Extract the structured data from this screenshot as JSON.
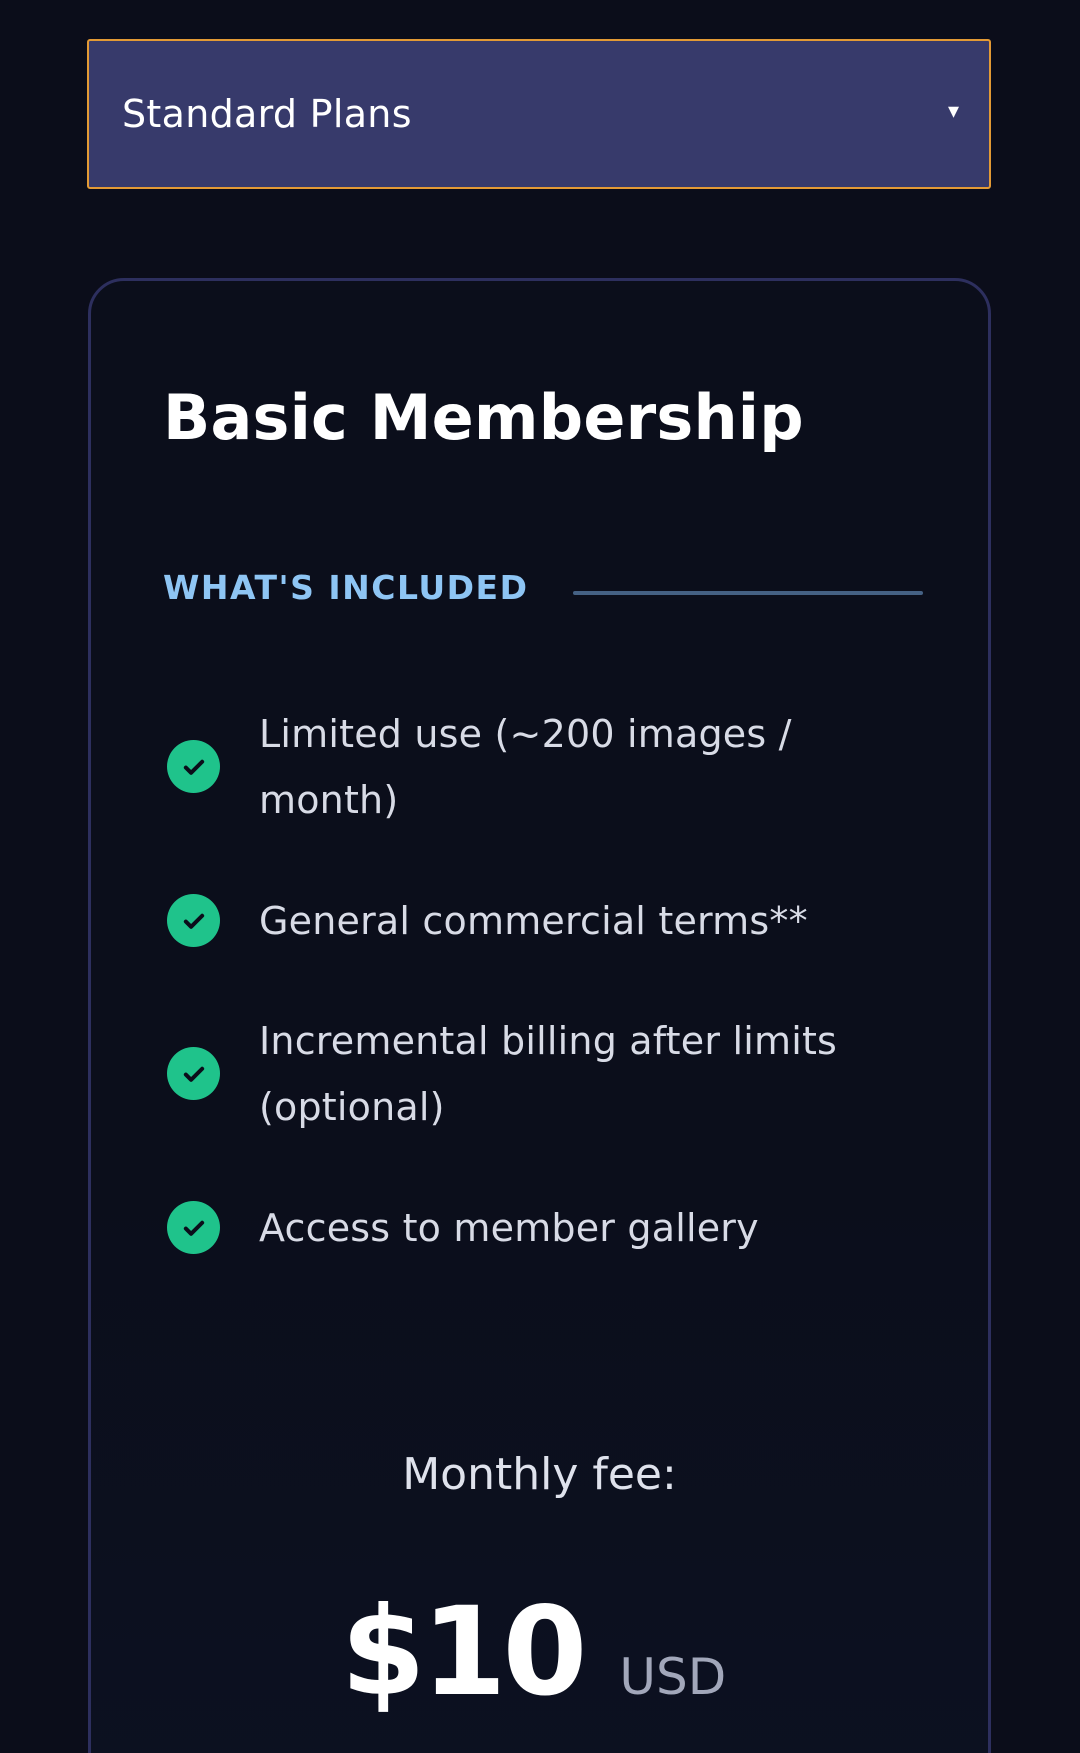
{
  "plan_selector": {
    "selected": "Standard Plans"
  },
  "card": {
    "title": "Basic Membership",
    "included_heading": "WHAT'S INCLUDED",
    "features": [
      "Limited use (~200 images / month)",
      "General commercial terms**",
      "Incremental billing after limits (optional)",
      "Access to member gallery"
    ],
    "fee_label": "Monthly fee:",
    "price": "$10",
    "currency": "USD"
  },
  "colors": {
    "background": "#0b0d1a",
    "select_bg": "#373a6b",
    "select_border": "#e39a35",
    "check_green": "#1fc38b",
    "heading_blue": "#8ec5f4"
  },
  "icons": {
    "select_caret": "caret-down-icon",
    "feature_check": "check-circle-icon"
  }
}
